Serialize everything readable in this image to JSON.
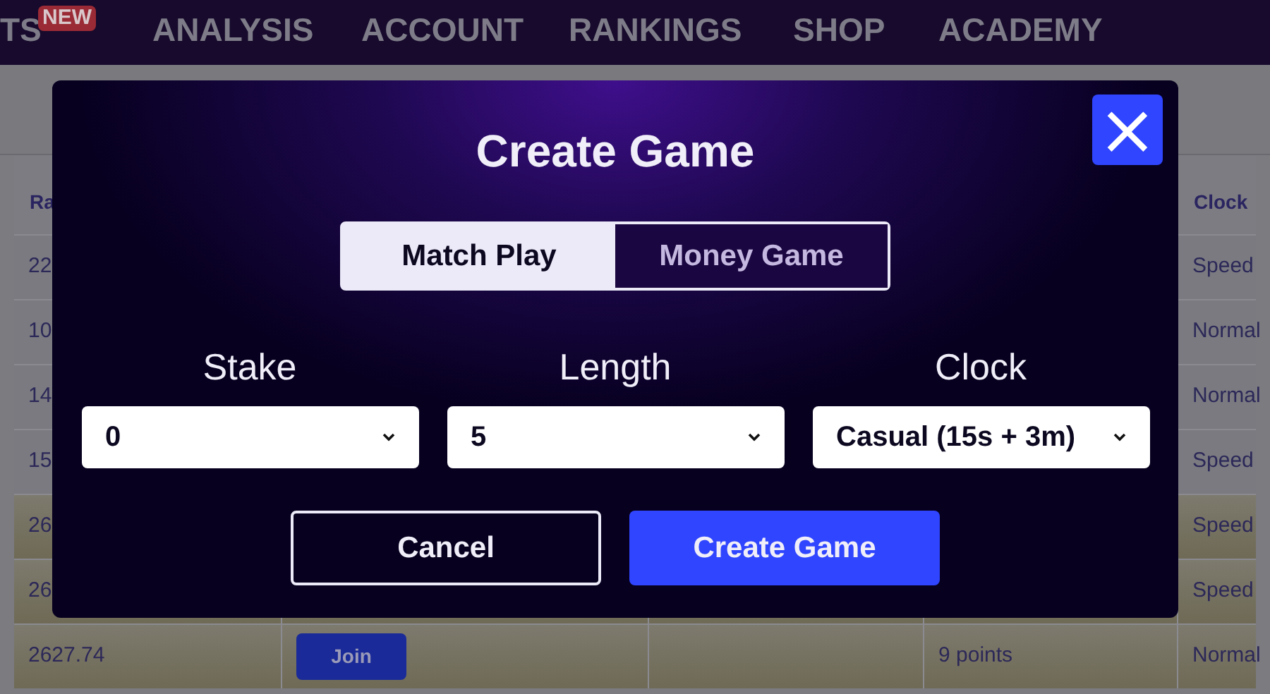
{
  "nav": {
    "items": [
      {
        "label": "TS",
        "badge": "NEW"
      },
      {
        "label": "ANALYSIS"
      },
      {
        "label": "ACCOUNT"
      },
      {
        "label": "RANKINGS"
      },
      {
        "label": "SHOP"
      },
      {
        "label": "ACADEMY"
      }
    ]
  },
  "table": {
    "columns": [
      "Ra",
      "",
      "",
      "",
      "Clock"
    ],
    "rows": [
      {
        "highlighted": false,
        "cells": [
          "22",
          "",
          "",
          "",
          "Speed"
        ]
      },
      {
        "highlighted": false,
        "cells": [
          "10",
          "",
          "",
          "",
          "Normal"
        ]
      },
      {
        "highlighted": false,
        "cells": [
          "14",
          "",
          "",
          "",
          "Normal"
        ]
      },
      {
        "highlighted": false,
        "cells": [
          "15",
          "",
          "",
          "",
          "Speed"
        ]
      },
      {
        "highlighted": true,
        "cells": [
          "26",
          "",
          "",
          "",
          "Speed"
        ]
      },
      {
        "highlighted": true,
        "cells": [
          "26",
          "",
          "",
          "",
          "Speed"
        ]
      },
      {
        "highlighted": true,
        "cells": [
          "2627.74",
          "Join",
          "",
          "9 points",
          "Normal"
        ]
      }
    ]
  },
  "dialog": {
    "title": "Create Game",
    "close": "×",
    "modes": [
      {
        "label": "Match Play",
        "selected": true
      },
      {
        "label": "Money Game",
        "selected": false
      }
    ],
    "fields": [
      {
        "label": "Stake",
        "value": "0"
      },
      {
        "label": "Length",
        "value": "5"
      },
      {
        "label": "Clock",
        "value": "Casual (15s + 3m)"
      }
    ],
    "buttons": [
      {
        "label": "Cancel",
        "kind": "secondary"
      },
      {
        "label": "Create Game",
        "kind": "primary"
      }
    ]
  }
}
